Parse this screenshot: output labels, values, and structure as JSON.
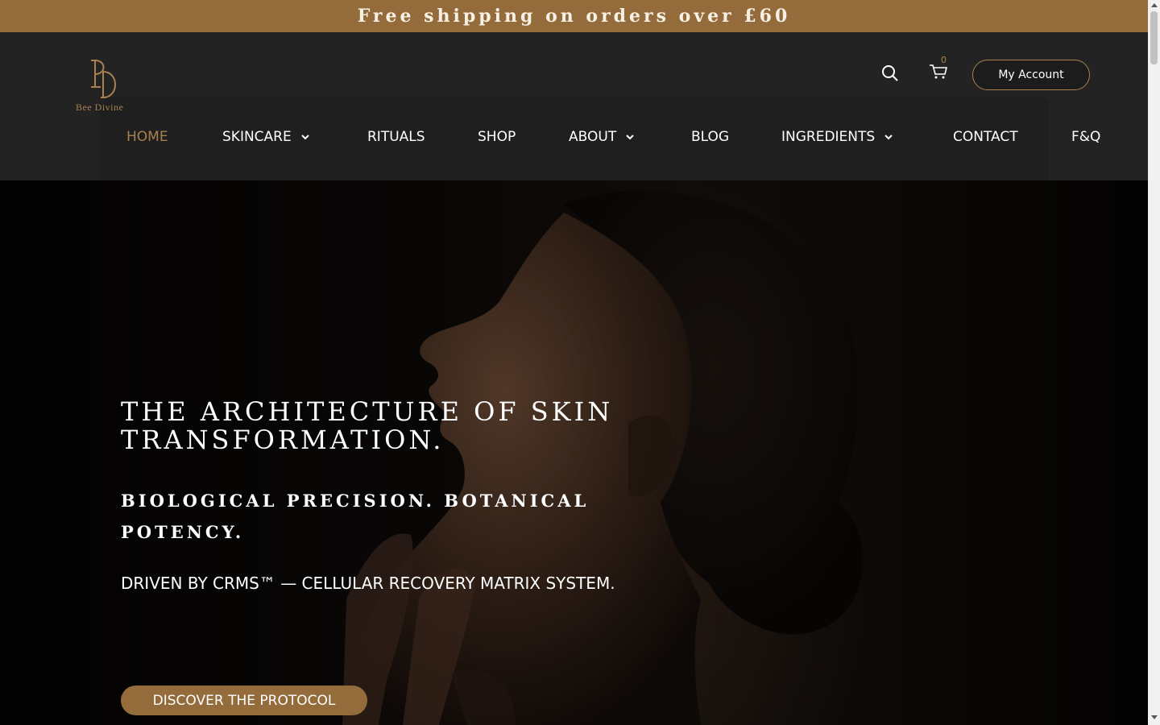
{
  "announcement": {
    "text": "Free shipping on orders over £60"
  },
  "brand": {
    "name": "Bee Divine",
    "monogram": "BD",
    "accent_color": "#946b3a",
    "gold_text_color": "#a98150"
  },
  "header": {
    "cart_count": "0",
    "account_label": "My Account",
    "icons": {
      "search": "search-icon",
      "cart": "cart-icon"
    }
  },
  "nav": {
    "items": [
      {
        "label": "HOME",
        "active": true,
        "dropdown": false
      },
      {
        "label": "SKINCARE",
        "active": false,
        "dropdown": true
      },
      {
        "label": "RITUALS",
        "active": false,
        "dropdown": false
      },
      {
        "label": "SHOP",
        "active": false,
        "dropdown": false
      },
      {
        "label": "ABOUT",
        "active": false,
        "dropdown": true
      },
      {
        "label": "BLOG",
        "active": false,
        "dropdown": false
      },
      {
        "label": "INGREDIENTS",
        "active": false,
        "dropdown": true
      },
      {
        "label": "CONTACT",
        "active": false,
        "dropdown": false
      },
      {
        "label": "F&Q",
        "active": false,
        "dropdown": false
      }
    ]
  },
  "hero": {
    "title": "THE ARCHITECTURE OF SKIN TRANSFORMATION.",
    "subtitle": "BIOLOGICAL PRECISION. BOTANICAL POTENCY.",
    "tagline": "DRIVEN BY CRMS™ — CELLULAR RECOVERY MATRIX SYSTEM.",
    "cta_label": "DISCOVER THE PROTOCOL"
  }
}
